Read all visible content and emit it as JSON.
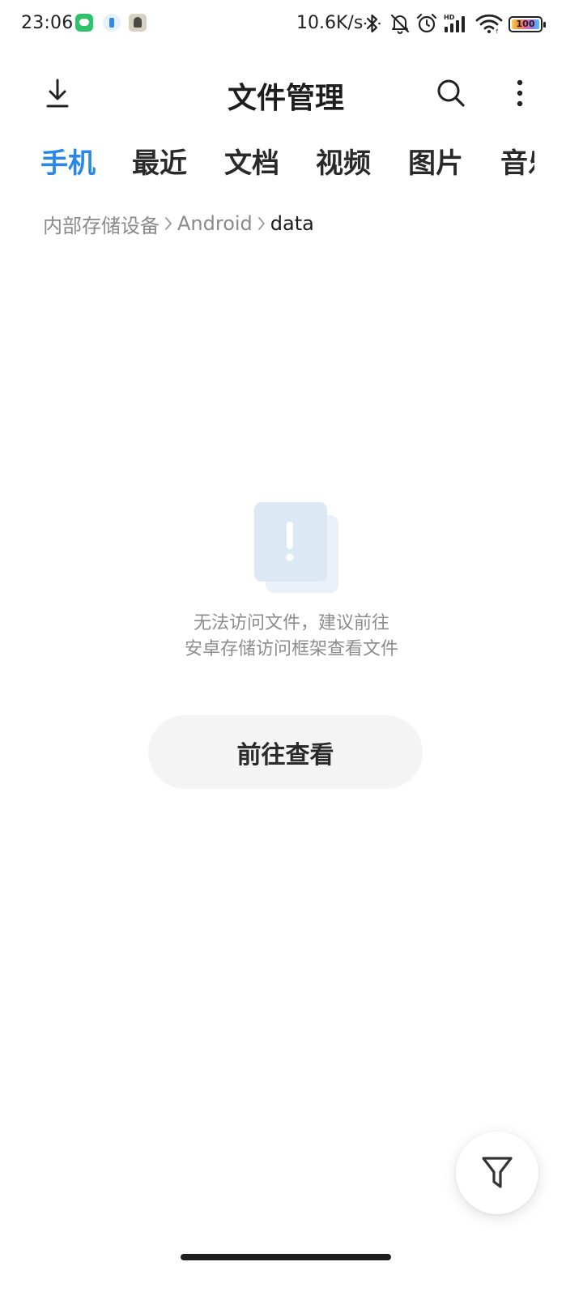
{
  "status_bar": {
    "time": "23:06",
    "network_speed": "10.6K/s",
    "battery": "100",
    "notification_icons": [
      "wechat-icon",
      "shield-icon",
      "avatar-icon"
    ],
    "system_icons": [
      "bluetooth-icon",
      "mute-bell-icon",
      "alarm-icon",
      "hd-signal-icon",
      "wifi-icon",
      "battery-icon"
    ]
  },
  "header": {
    "title": "文件管理",
    "left_icon": "download-icon",
    "right_icons": [
      "search-icon",
      "more-vertical-icon"
    ]
  },
  "tabs": [
    {
      "label": "手机",
      "active": true
    },
    {
      "label": "最近",
      "active": false
    },
    {
      "label": "文档",
      "active": false
    },
    {
      "label": "视频",
      "active": false
    },
    {
      "label": "图片",
      "active": false
    },
    {
      "label": "音乐",
      "active": false
    }
  ],
  "breadcrumb": [
    {
      "label": "内部存储设备"
    },
    {
      "label": "Android"
    },
    {
      "label": "data",
      "current": true
    }
  ],
  "empty_state": {
    "icon": "warning-document-icon",
    "message_line1": "无法访问文件，建议前往",
    "message_line2": "安卓存储访问框架查看文件",
    "button_label": "前往查看"
  },
  "fab": {
    "icon": "filter-icon"
  },
  "colors": {
    "accent": "#2a87ea",
    "text_primary": "#1f1f1f",
    "text_secondary": "#8a8a8a",
    "button_bg": "#f4f4f4"
  }
}
